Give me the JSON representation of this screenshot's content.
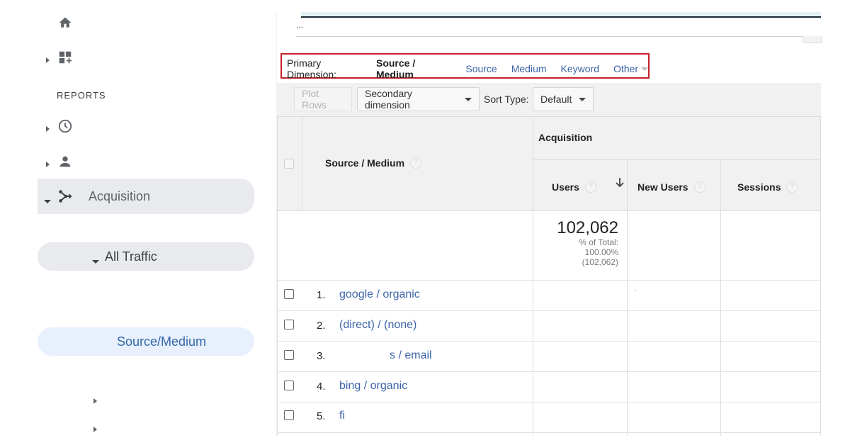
{
  "sidebar": {
    "reports_label": "REPORTS",
    "icons": [
      "home-icon",
      "dashboard-icon",
      "clock-icon",
      "person-icon",
      "acquisition-icon"
    ],
    "acquisition_label": "Acquisition",
    "all_traffic_label": "All Traffic",
    "source_medium_label": "Source/Medium"
  },
  "top": {
    "input_value": "..."
  },
  "primary_dimension": {
    "label": "Primary Dimension:",
    "active": "Source / Medium",
    "links": [
      "Source",
      "Medium",
      "Keyword"
    ],
    "other": "Other"
  },
  "toolbar": {
    "plot_rows": "Plot Rows",
    "secondary_dimension": "Secondary dimension",
    "sort_type_label": "Sort Type:",
    "sort_type_value": "Default"
  },
  "table": {
    "dimension_header": "Source / Medium",
    "group_header": "Acquisition",
    "columns": [
      "Users",
      "New Users",
      "Sessions"
    ],
    "help_glyph": "?",
    "totals": {
      "users": "102,062",
      "pct_label": "% of Total:",
      "pct_value": "100.00%",
      "pct_count": "(102,062)"
    },
    "rows": [
      {
        "num": "1.",
        "label": "google / organic"
      },
      {
        "num": "2.",
        "label": "(direct) / (none)"
      },
      {
        "num": "3.",
        "label": "s / email"
      },
      {
        "num": "4.",
        "label": "bing / organic"
      },
      {
        "num": "5.",
        "label": "fi"
      }
    ]
  },
  "colors": {
    "highlight_border": "#c5222b",
    "link": "#3c64a8",
    "active_nav_bg": "#e8f0fe",
    "nav_pill_bg": "#e8eaed"
  }
}
